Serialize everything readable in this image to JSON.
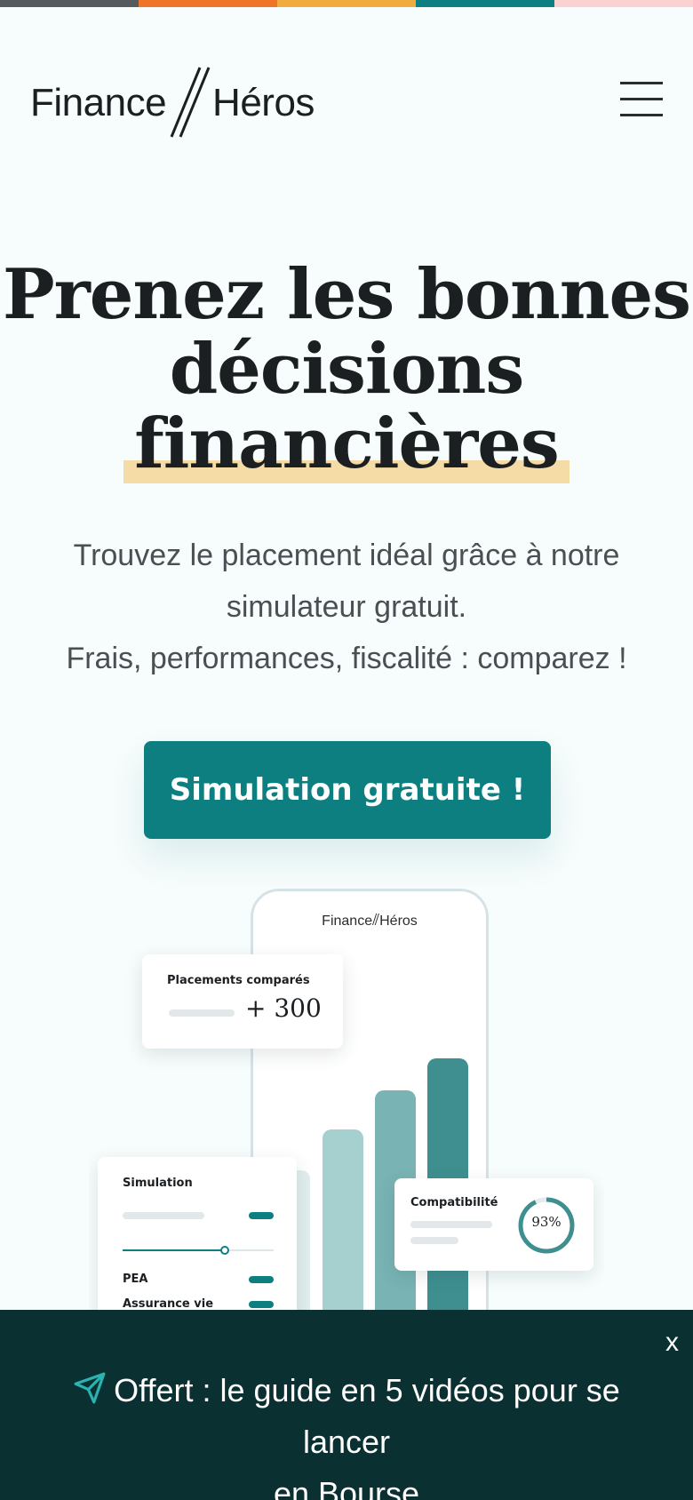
{
  "colors": {
    "stripe": [
      "#555a5f",
      "#f07427",
      "#f0ad3e",
      "#0e7f80",
      "#fbd2d2"
    ],
    "accent": "#0e7f80",
    "banner": "#0a3032",
    "highlight": "#f5dba5"
  },
  "header": {
    "logo_left": "Finance",
    "logo_right": "Héros",
    "menu_icon": "hamburger-menu-icon"
  },
  "hero": {
    "title_line1": "Prenez les bonnes",
    "title_line2": "décisions",
    "title_line3": "financières",
    "subtitle_line1": "Trouvez le placement idéal grâce à notre",
    "subtitle_line2": "simulateur gratuit.",
    "subtitle_line3": "Frais, performances, fiscalité : comparez !",
    "cta_label": "Simulation gratuite !"
  },
  "illustration": {
    "phone_logo_left": "Finance",
    "phone_logo_right": "Héros",
    "placements_title": "Placements comparés",
    "placements_value": "+ 300",
    "simulation_title": "Simulation",
    "simulation_items": [
      "PEA",
      "Assurance vie"
    ],
    "compat_title": "Compatibilité",
    "compat_value": "93%",
    "compat_percent": 93
  },
  "banner": {
    "close_label": "x",
    "icon": "paper-plane-icon",
    "text_line1": "Offert : le guide en 5 vidéos pour se lancer",
    "text_line2": "en Bourse"
  }
}
